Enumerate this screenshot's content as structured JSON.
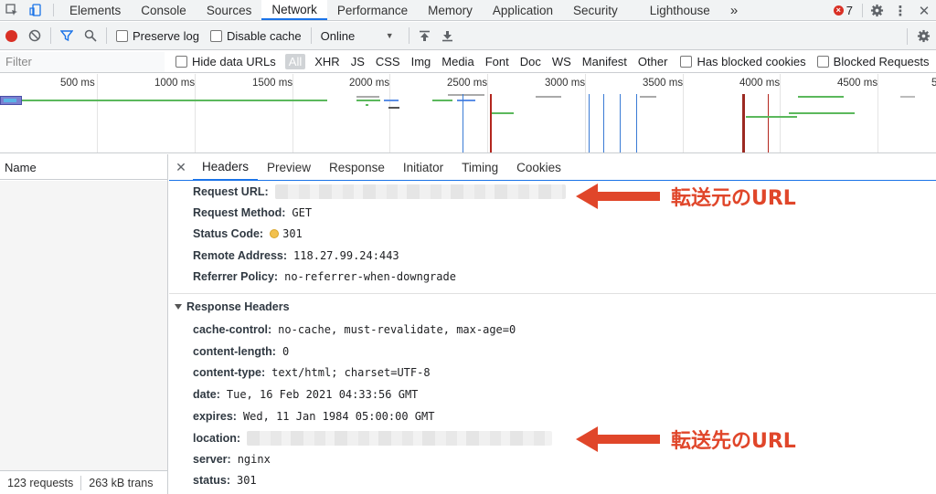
{
  "tabs": {
    "items": [
      "Elements",
      "Console",
      "Sources",
      "Network",
      "Performance",
      "Memory",
      "Application",
      "Security",
      "Lighthouse"
    ],
    "more": "»",
    "error_count": "7"
  },
  "toolbar": {
    "preserve_log": "Preserve log",
    "disable_cache": "Disable cache",
    "throttle": "Online"
  },
  "filterbar": {
    "placeholder": "Filter",
    "hide_data_urls": "Hide data URLs",
    "types": [
      "All",
      "XHR",
      "JS",
      "CSS",
      "Img",
      "Media",
      "Font",
      "Doc",
      "WS",
      "Manifest",
      "Other"
    ],
    "has_blocked_cookies": "Has blocked cookies",
    "blocked_requests": "Blocked Requests"
  },
  "timeline": {
    "ticks": [
      "500 ms",
      "1000 ms",
      "1500 ms",
      "2000 ms",
      "2500 ms",
      "3000 ms",
      "3500 ms",
      "4000 ms",
      "4500 ms",
      "5"
    ]
  },
  "namecol": {
    "header": "Name",
    "requests": "123 requests",
    "transferred": "263 kB trans"
  },
  "details": {
    "tabs": [
      "Headers",
      "Preview",
      "Response",
      "Initiator",
      "Timing",
      "Cookies"
    ],
    "general": [
      {
        "k": "Request URL:",
        "v": ""
      },
      {
        "k": "Request Method:",
        "v": "GET"
      },
      {
        "k": "Status Code:",
        "v": "301"
      },
      {
        "k": "Remote Address:",
        "v": "118.27.99.24:443"
      },
      {
        "k": "Referrer Policy:",
        "v": "no-referrer-when-downgrade"
      }
    ],
    "response_headers_title": "Response Headers",
    "response": [
      {
        "k": "cache-control:",
        "v": "no-cache, must-revalidate, max-age=0"
      },
      {
        "k": "content-length:",
        "v": "0"
      },
      {
        "k": "content-type:",
        "v": "text/html; charset=UTF-8"
      },
      {
        "k": "date:",
        "v": "Tue, 16 Feb 2021 04:33:56 GMT"
      },
      {
        "k": "expires:",
        "v": "Wed, 11 Jan 1984 05:00:00 GMT"
      },
      {
        "k": "location:",
        "v": ""
      },
      {
        "k": "server:",
        "v": "nginx"
      },
      {
        "k": "status:",
        "v": "301"
      }
    ]
  },
  "annotations": {
    "source": "転送元のURL",
    "dest": "転送先のURL",
    "color": "#e0462a"
  }
}
